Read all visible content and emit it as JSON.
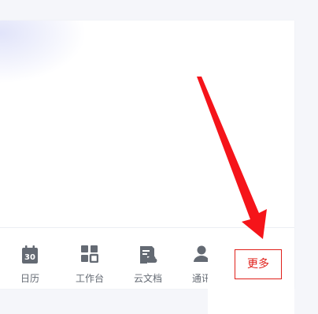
{
  "tabbar": {
    "items": [
      {
        "label": "日历",
        "icon": "calendar-icon",
        "icon_text": "30"
      },
      {
        "label": "工作台",
        "icon": "workspace-grid-icon"
      },
      {
        "label": "云文档",
        "icon": "cloud-doc-icon"
      },
      {
        "label": "通讯",
        "icon": "contacts-icon"
      }
    ],
    "more_label": "更多"
  },
  "colors": {
    "icon_gray": "#646a73",
    "highlight_red": "#e0201a"
  },
  "annotation": {
    "icon": "red-arrow-icon"
  }
}
